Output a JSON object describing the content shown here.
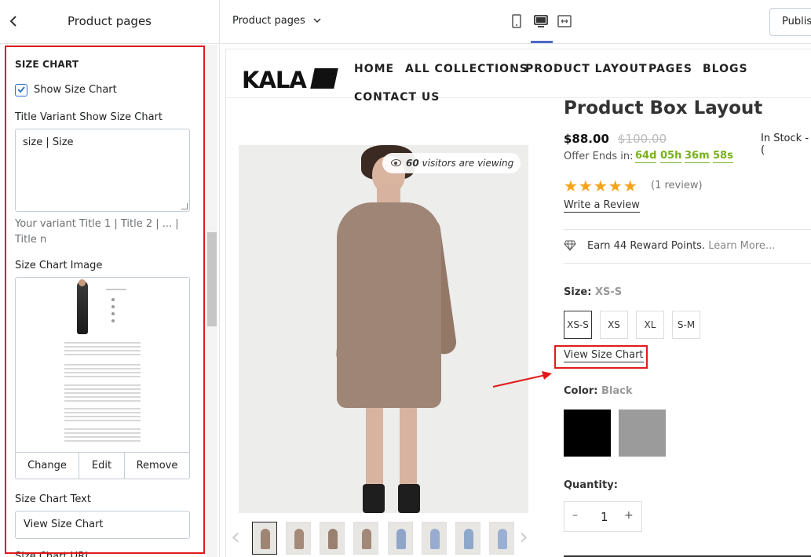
{
  "sidebar": {
    "title": "Product pages",
    "section_title": "SIZE CHART",
    "show_size_chart_label": "Show Size Chart",
    "show_size_chart_checked": true,
    "title_variant_label": "Title Variant Show Size Chart",
    "title_variant_value": "size | Size",
    "title_variant_help": "Your variant Title 1 | Title 2 | ... | Title n",
    "size_chart_image_label": "Size Chart Image",
    "image_actions": {
      "change": "Change",
      "edit": "Edit",
      "remove": "Remove"
    },
    "size_chart_text_label": "Size Chart Text",
    "size_chart_text_value": "View Size Chart",
    "size_chart_url_label": "Size Chart URL"
  },
  "topbar": {
    "page_select": "Product pages",
    "view_icons": [
      "mobile-icon",
      "desktop-icon",
      "fullscreen-icon"
    ],
    "active_view": "desktop-icon",
    "publish_label": "Publis"
  },
  "store": {
    "logo": "KALA",
    "nav": [
      "HOME",
      "ALL COLLECTIONS",
      "PRODUCT LAYOUT",
      "PAGES",
      "BLOGS",
      "CONTACT US"
    ],
    "visitors_count": "60",
    "visitors_text": "visitors are viewing",
    "product": {
      "title": "Product Box Layout",
      "price": "$88.00",
      "compare_price": "$100.00",
      "stock": "In Stock - (",
      "offer_label": "Offer Ends in:",
      "timer": [
        "64d",
        "05h",
        "36m",
        "58s"
      ],
      "rating": 5,
      "stars": "★★★★★",
      "reviews": "(1 review)",
      "write_review": "Write a Review",
      "reward_text": "Earn 44 Reward Points.",
      "reward_link": "Learn More...",
      "size_label": "Size:",
      "size_value": "XS-S",
      "sizes": [
        "XS-S",
        "XS",
        "XL",
        "S-M"
      ],
      "view_size_chart": "View Size Chart",
      "color_label": "Color:",
      "color_value": "Black",
      "colors": [
        "#000000",
        "#9b9b9b"
      ],
      "quantity_label": "Quantity:",
      "qty_minus": "–",
      "quantity": "1",
      "qty_plus": "+"
    }
  },
  "colors": {
    "accent_red": "#e11b1b",
    "timer_green": "#78b11b",
    "star_orange": "#f7a21b",
    "checkbox_blue": "#2c6ecb"
  }
}
